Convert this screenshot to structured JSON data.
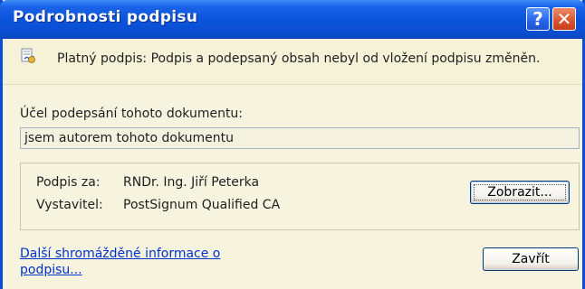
{
  "window": {
    "title": "Podrobnosti podpisu",
    "help_glyph": "?",
    "close_glyph": "✕"
  },
  "infobar": {
    "icon": "valid-signature-icon",
    "text": "Platný podpis: Podpis a podepsaný obsah nebyl od vložení podpisu změněn."
  },
  "purpose": {
    "label": "Účel podepsání tohoto dokumentu:",
    "value": "jsem autorem tohoto dokumentu"
  },
  "signature": {
    "signed_by_label": "Podpis za:",
    "signed_by_value": "RNDr. Ing. Jiří Peterka",
    "issuer_label": "Vystavitel:",
    "issuer_value": "PostSignum Qualified CA",
    "show_button": "Zobrazit..."
  },
  "footer": {
    "more_info_link_line1": "Další shromážděné informace o",
    "more_info_link_line2": "podpisu...",
    "close_button": "Zavřít"
  },
  "colors": {
    "titlebar": "#0a54dc",
    "dialog_bg": "#f6f3df",
    "link": "#0033cc"
  }
}
